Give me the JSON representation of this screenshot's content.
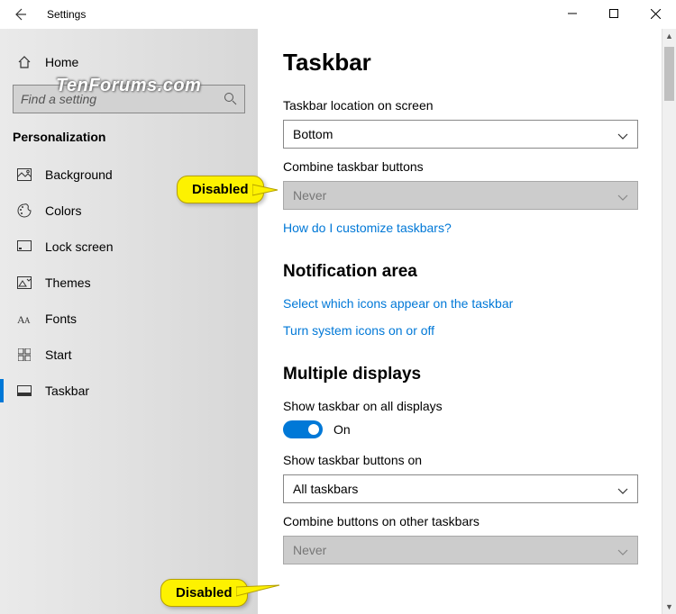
{
  "window": {
    "title": "Settings"
  },
  "watermark": "TenForums.com",
  "sidebar": {
    "home": "Home",
    "search_placeholder": "Find a setting",
    "category": "Personalization",
    "items": [
      {
        "label": "Background"
      },
      {
        "label": "Colors"
      },
      {
        "label": "Lock screen"
      },
      {
        "label": "Themes"
      },
      {
        "label": "Fonts"
      },
      {
        "label": "Start"
      },
      {
        "label": "Taskbar"
      }
    ]
  },
  "main": {
    "title": "Taskbar",
    "location_label": "Taskbar location on screen",
    "location_value": "Bottom",
    "combine_label": "Combine taskbar buttons",
    "combine_value": "Never",
    "help_link": "How do I customize taskbars?",
    "notif_heading": "Notification area",
    "notif_link1": "Select which icons appear on the taskbar",
    "notif_link2": "Turn system icons on or off",
    "multi_heading": "Multiple displays",
    "multi_show_label": "Show taskbar on all displays",
    "multi_show_state": "On",
    "multi_buttons_label": "Show taskbar buttons on",
    "multi_buttons_value": "All taskbars",
    "multi_combine_label": "Combine buttons on other taskbars",
    "multi_combine_value": "Never"
  },
  "annotations": {
    "callout1": "Disabled",
    "callout2": "Disabled"
  }
}
